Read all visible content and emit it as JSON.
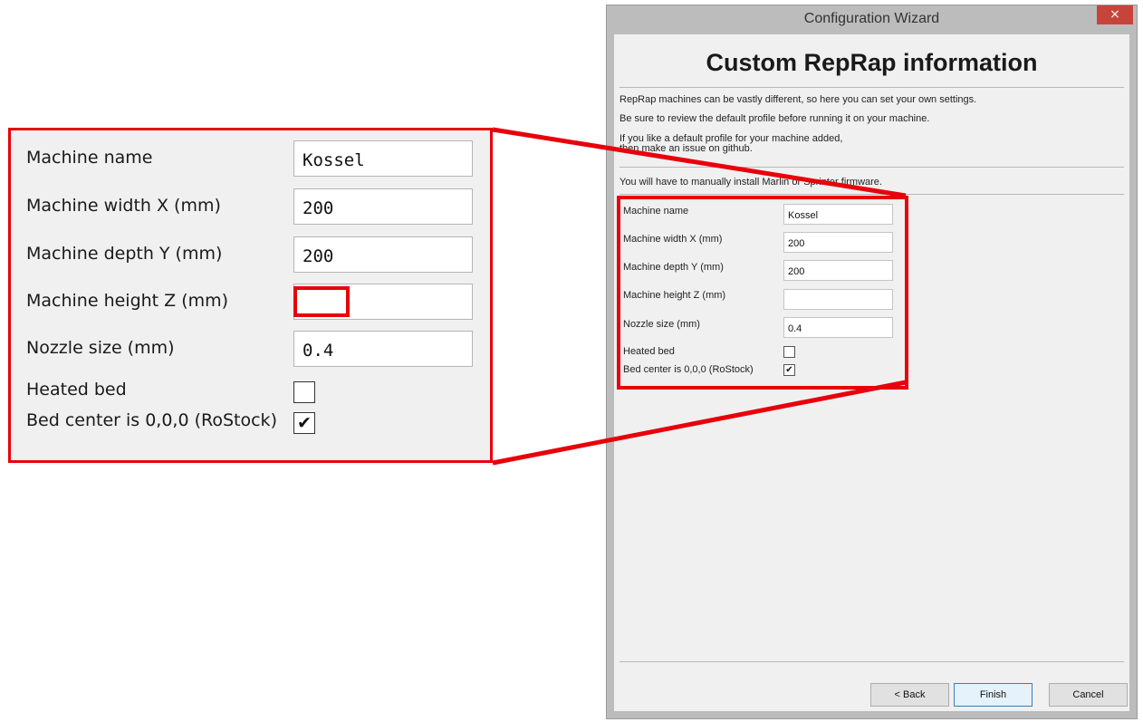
{
  "window": {
    "title": "Configuration Wizard",
    "close_glyph": "×"
  },
  "page": {
    "title": "Custom RepRap information",
    "description": [
      "RepRap machines can be vastly different, so here you can set your own settings.",
      "Be sure to review the default profile before running it on your machine.",
      "If you like a default profile for your machine added,",
      "then make an issue on github.",
      "You will have to manually install Marlin or Sprinter firmware."
    ]
  },
  "fields": [
    {
      "label": "Machine name",
      "value": "Kossel"
    },
    {
      "label": "Machine width X (mm)",
      "value": "200"
    },
    {
      "label": "Machine depth Y (mm)",
      "value": "200"
    },
    {
      "label": "Machine height Z (mm)",
      "value": ""
    },
    {
      "label": "Nozzle size (mm)",
      "value": "0.4"
    }
  ],
  "checkboxes": [
    {
      "label": "Heated bed",
      "checked": false,
      "glyph": ""
    },
    {
      "label": "Bed center is 0,0,0 (RoStock)",
      "checked": true,
      "glyph": "✔"
    }
  ],
  "buttons": {
    "back": "< Back",
    "finish": "Finish",
    "cancel": "Cancel"
  },
  "colors": {
    "highlight": "#e8000b",
    "window_frame": "#bcbcbc",
    "close_button": "#c7443a"
  }
}
